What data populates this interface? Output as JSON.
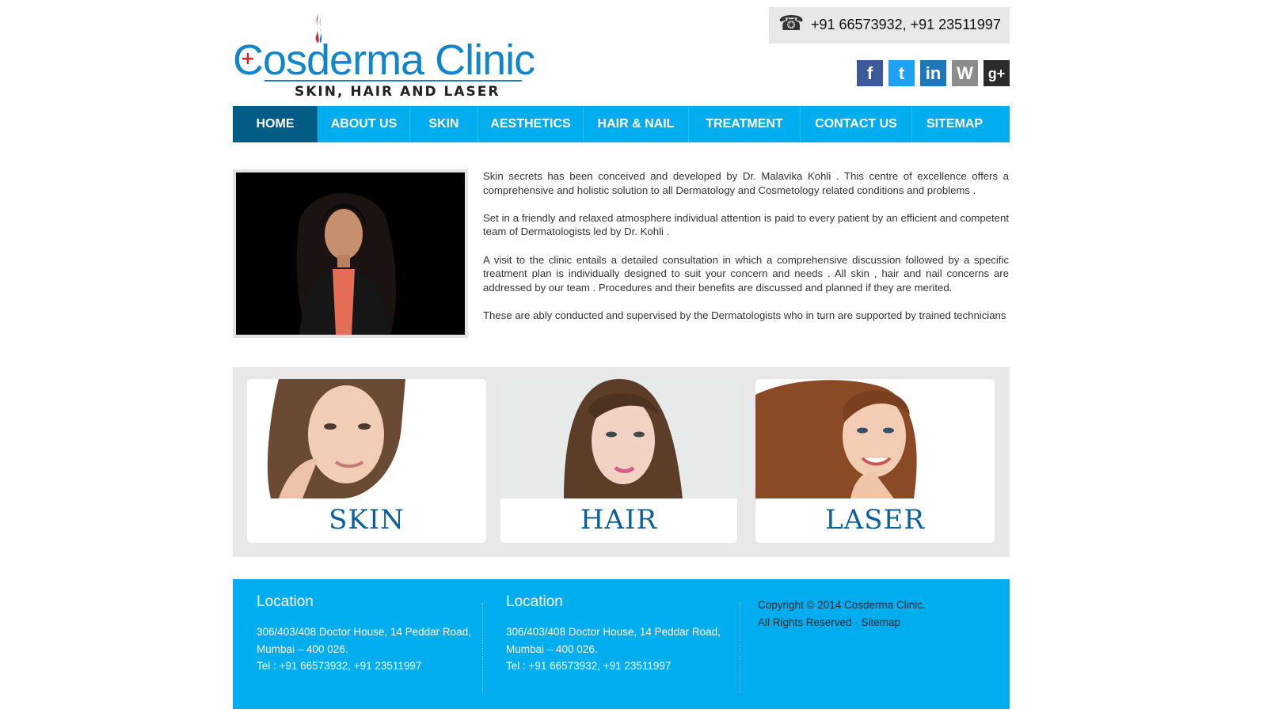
{
  "logo": {
    "main": "Cosderma Clinic",
    "tagline": "SKIN, HAIR AND LASER",
    "cross": "+"
  },
  "header": {
    "phone_icon": "telephone-icon",
    "phone": "+91 66573932, +91 23511997",
    "social": [
      {
        "name": "facebook-icon",
        "glyph": "f",
        "color": "#3b5998"
      },
      {
        "name": "twitter-icon",
        "glyph": "t",
        "color": "#1da1f2"
      },
      {
        "name": "linkedin-icon",
        "glyph": "in",
        "color": "#1e78b7"
      },
      {
        "name": "wordpress-icon",
        "glyph": "W",
        "color": "#8c8c8c"
      },
      {
        "name": "google-plus-icon",
        "glyph": "g+",
        "color": "#2b2b2b"
      }
    ]
  },
  "nav": {
    "items": [
      "HOME",
      "ABOUT US",
      "SKIN",
      "AESTHETICS",
      "HAIR & NAIL",
      "TREATMENT",
      "CONTACT US",
      "SITEMAP"
    ],
    "active": "HOME",
    "accent": "#00adef",
    "active_color": "#005b85"
  },
  "intro": {
    "paragraphs": [
      "Skin secrets has been conceived and developed by Dr. Malavika Kohli . This centre of excellence offers a comprehensive and holistic solution to all Dermatology and Cosmetology related conditions and problems .",
      "Set in a friendly and relaxed atmosphere individual attention is paid to every patient by an efficient and competent team of Dermatologists led by Dr. Kohli .",
      "A visit to the clinic entails a detailed consultation in which a comprehensive discussion followed by a specific treatment plan is individually designed to suit your concern and needs . All skin , hair and nail concerns are addressed by our team . Procedures and their benefits are discussed and planned if they are merited.",
      "These are ably conducted and supervised by the Dermatologists who in turn are supported by trained technicians"
    ]
  },
  "services": [
    {
      "label": "SKIN"
    },
    {
      "label": "HAIR"
    },
    {
      "label": "LASER"
    }
  ],
  "footer": {
    "locations": [
      {
        "title": "Location",
        "address1": "306/403/408 Doctor House, 14 Peddar Road,",
        "address2": "Mumbai – 400 026.",
        "tel": "Tel : +91 66573932, +91 23511997"
      },
      {
        "title": "Location",
        "address1": "306/403/408 Doctor House, 14 Peddar Road,",
        "address2": "Mumbai – 400 026.",
        "tel": "Tel : +91 66573932, +91 23511997"
      }
    ],
    "copyright": "Copyright © 2014 Cosderma Clinic.",
    "rights": "All Rights Reserved · Sitemap"
  }
}
